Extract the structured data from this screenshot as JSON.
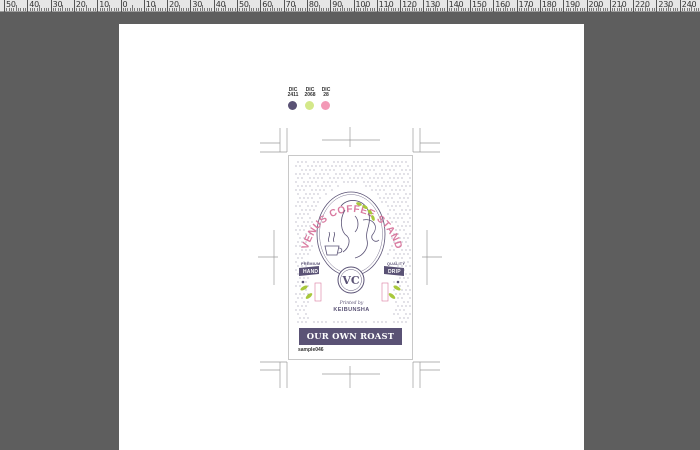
{
  "ruler": {
    "labels": [
      "50",
      "40",
      "30",
      "20",
      "10",
      "0",
      "10",
      "20",
      "30",
      "40",
      "50",
      "60",
      "70",
      "80",
      "90",
      "100",
      "110",
      "120",
      "130",
      "140",
      "150",
      "160",
      "170",
      "180",
      "190",
      "200",
      "210",
      "220",
      "230",
      "240",
      "250"
    ]
  },
  "swatches": [
    {
      "label_top": "DIC",
      "label_bottom": "2411",
      "color": "#5a5275"
    },
    {
      "label_top": "DIC",
      "label_bottom": "2068",
      "color": "#d4e88a"
    },
    {
      "label_top": "DIC",
      "label_bottom": "28",
      "color": "#f39ab6"
    }
  ],
  "label": {
    "brand_arc": "VENUS COFFEE STAND",
    "left_top": "PREMIUM",
    "left_main": "HAND",
    "right_top": "QUALITY",
    "right_main": "DRIP",
    "emblem_initials": "VC",
    "printed_by": "Printed by",
    "printer": "KEIBUNSHA",
    "banner": "OUR OWN ROAST"
  },
  "file_label": "sample046",
  "colors": {
    "ink": "#5a5275",
    "pink": "#d97aa0",
    "green": "#a8c83c",
    "canvas": "#5e5e5e",
    "artboard": "#ffffff"
  }
}
